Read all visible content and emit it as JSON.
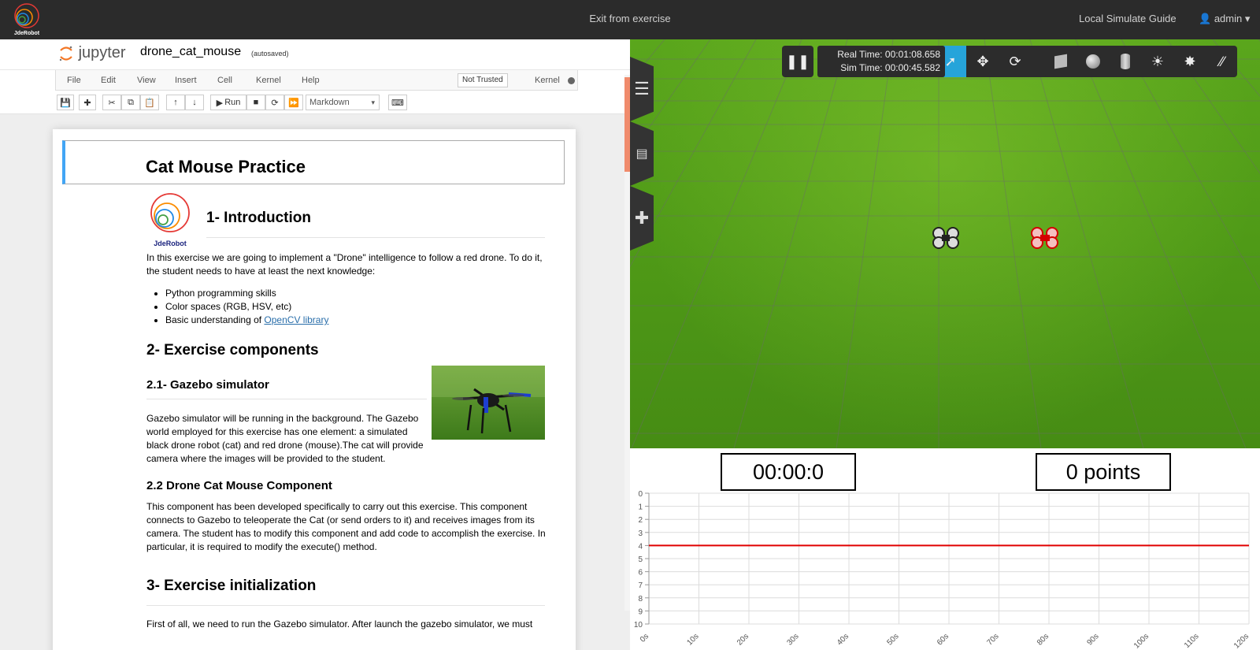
{
  "topbar": {
    "logo_text": "JdeRobot",
    "center_link": "Exit from exercise",
    "guide_link": "Local Simulate Guide",
    "user": "admin"
  },
  "notebook": {
    "brand": "jupyter",
    "title": "drone_cat_mouse",
    "autosaved": "(autosaved)",
    "menu": [
      "File",
      "Edit",
      "View",
      "Insert",
      "Cell",
      "Kernel",
      "Help"
    ],
    "not_trusted": "Not Trusted",
    "kernel_label": "Kernel",
    "run_label": "Run",
    "cell_type": "Markdown"
  },
  "doc": {
    "title": "Cat Mouse Practice",
    "logo_label": "JdeRobot",
    "intro_heading": "1- Introduction",
    "intro_text": "In this exercise we are going to implement a \"Drone\" intelligence to follow a red drone. To do it, the student needs to have at least the next knowledge:",
    "bullets": [
      "Python programming skills",
      "Color spaces (RGB, HSV, etc)",
      "Basic understanding of "
    ],
    "bullet_link": "OpenCV library",
    "components_heading": "2- Exercise components",
    "gazebo_heading": "2.1- Gazebo simulator",
    "gazebo_text": "Gazebo simulator will be running in the background. The Gazebo world employed for this exercise has one element: a simulated black drone robot (cat) and red drone (mouse).The cat will provide camera where the images will be provided to the student.",
    "component_heading": "2.2 Drone Cat Mouse Component",
    "component_text": "This component has been developed specifically to carry out this exercise. This component connects to Gazebo to teleoperate the Cat (or send orders to it) and receives images from its camera. The student has to modify this component and add code to accomplish the exercise. In particular, it is required to modify the execute() method.",
    "init_heading": "3- Exercise initialization",
    "init_text": "First of all, we need to run the Gazebo simulator. After launch the gazebo simulator, we must"
  },
  "gazebo": {
    "real_time": "Real Time: 00:01:08.658",
    "sim_time": "Sim Time: 00:00:45.582"
  },
  "score": {
    "timer": "00:00:0",
    "points": "0 points"
  },
  "chart_data": {
    "type": "line",
    "x_ticks": [
      "0s",
      "10s",
      "20s",
      "30s",
      "40s",
      "50s",
      "60s",
      "70s",
      "80s",
      "90s",
      "100s",
      "110s",
      "120s"
    ],
    "y_ticks": [
      "0",
      "1",
      "2",
      "3",
      "4",
      "5",
      "6",
      "7",
      "8",
      "9",
      "10"
    ],
    "y_inverted": true,
    "ylim": [
      0,
      10
    ],
    "xlim": [
      0,
      120
    ],
    "series": [
      {
        "color": "#e00000",
        "x": [
          0,
          120
        ],
        "y": [
          4,
          4
        ]
      }
    ],
    "grid": true
  }
}
